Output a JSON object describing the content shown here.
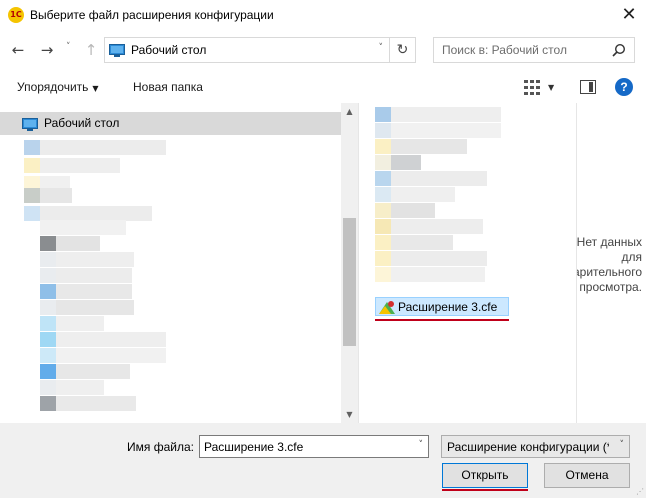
{
  "window": {
    "title": "Выберите файл расширения конфигурации",
    "logo_text": "1С",
    "close_glyph": "✕"
  },
  "nav": {
    "back_glyph": "←",
    "forward_glyph": "→",
    "recent_glyph": "˅",
    "up_glyph": "↑",
    "address": "Рабочий стол",
    "address_chevron": "˅",
    "refresh_glyph": "↻",
    "search_placeholder": "Поиск в: Рабочий стол"
  },
  "toolbar": {
    "organize_label": "Упорядочить",
    "organize_caret": "▼",
    "new_folder_label": "Новая папка",
    "view_caret": "▼",
    "help_glyph": "?"
  },
  "tree": {
    "selected_label": "Рабочий стол"
  },
  "scrollbar": {
    "up_glyph": "▲",
    "down_glyph": "▼"
  },
  "files": {
    "selected_file": "Расширение 3.cfe"
  },
  "preview": {
    "line1": "Нет данных",
    "line2": "для",
    "line3": "предварительного",
    "line4": "просмотра."
  },
  "bottom": {
    "filename_label": "Имя файла:",
    "filename_value": "Расширение 3.cfe",
    "filename_chevron": "˅",
    "filter_value": "Расширение конфигурации (*.cfe)",
    "filter_chevron": "˅",
    "open_label": "Открыть",
    "cancel_label": "Отмена",
    "grip_glyph": "⋰"
  },
  "colors": {
    "accent": "#0078d7",
    "highlight_underline": "#c0001a",
    "selection_bg": "#cce8ff",
    "tree_selected_bg": "#d9d9d9",
    "help_blue": "#1569c7"
  }
}
